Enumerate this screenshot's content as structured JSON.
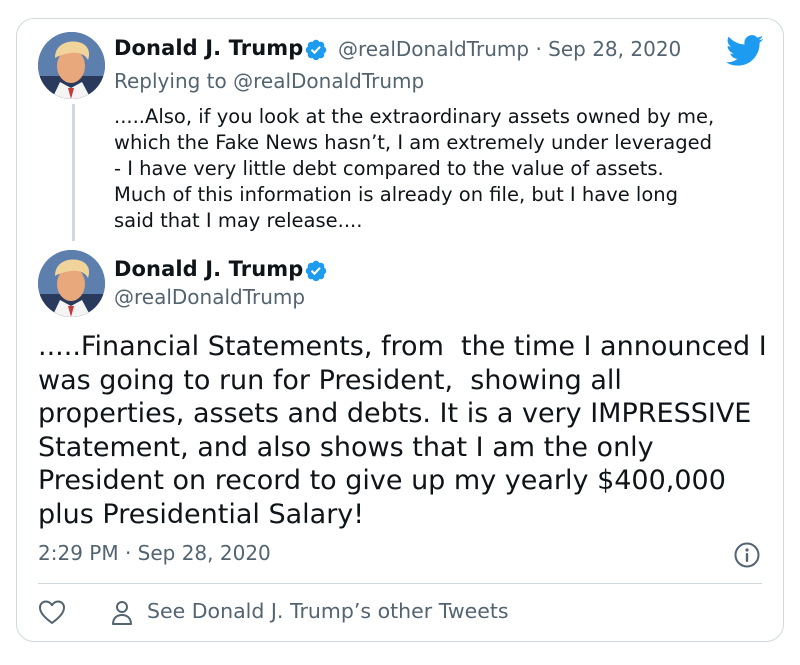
{
  "colors": {
    "brand": "#1d9bf0",
    "text_primary": "#0f1419",
    "text_secondary": "#536471",
    "border": "#cfd9de"
  },
  "icons": {
    "brand": "twitter-bird-icon",
    "verified": "verified-badge-icon",
    "info": "info-icon",
    "like": "heart-icon",
    "profile": "person-icon"
  },
  "parent_tweet": {
    "author_name": "Donald J. Trump",
    "handle": "@realDonaldTrump",
    "separator": "·",
    "date": "Sep 28, 2020",
    "replying_to_prefix": "Replying to",
    "replying_to_handle": "@realDonaldTrump",
    "lines": [
      ".....Also, if you look at the extraordinary assets owned by me,",
      "which the Fake News hasn’t, I am extremely under leveraged",
      "- I have very little debt compared to the value of assets.",
      "Much of this information is already on file, but I have long",
      "said that I may release...."
    ]
  },
  "main_tweet": {
    "author_name": "Donald J. Trump",
    "handle": "@realDonaldTrump",
    "lines": [
      ".....Financial Statements, from  the time I announced I",
      "was going to run for President,  showing all",
      "properties, assets and debts. It is a very IMPRESSIVE",
      "Statement, and also shows that I am the only",
      "President on record to give up my yearly $400,000",
      "plus Presidential Salary!"
    ],
    "timestamp": "2:29 PM · Sep 28, 2020"
  },
  "footer": {
    "other_tweets_label": "See Donald J. Trump’s other Tweets"
  }
}
